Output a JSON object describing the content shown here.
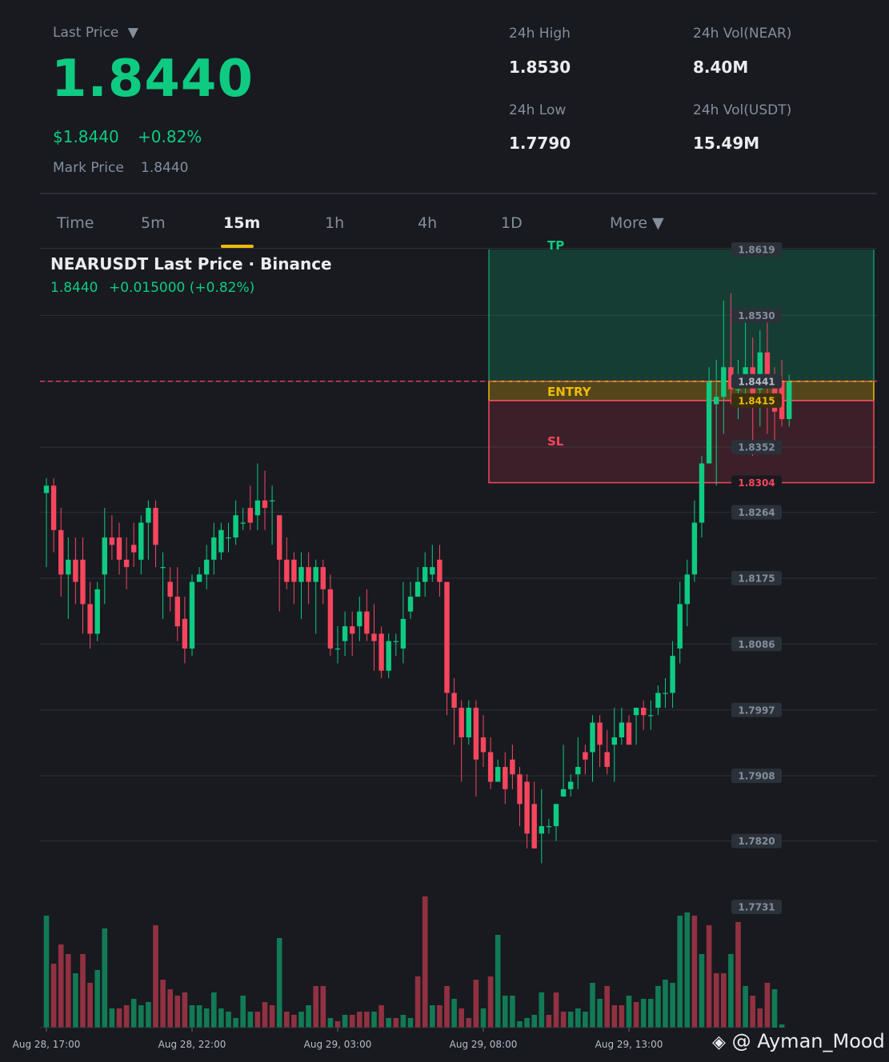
{
  "header": {
    "last_price_label": "Last Price",
    "last_price_caret": "▼",
    "last_price": "1.8440",
    "usd_price": "$1.8440",
    "change_pct": "+0.82%",
    "mark_price_label": "Mark Price",
    "mark_price": "1.8440",
    "stats": [
      {
        "label": "24h High",
        "value": "1.8530"
      },
      {
        "label": "24h Vol(NEAR)",
        "value": "8.40M"
      },
      {
        "label": "24h Low",
        "value": "1.7790"
      },
      {
        "label": "24h Vol(USDT)",
        "value": "15.49M"
      }
    ]
  },
  "tabs": [
    {
      "label": "Time",
      "active": false
    },
    {
      "label": "5m",
      "active": false
    },
    {
      "label": "15m",
      "active": true
    },
    {
      "label": "1h",
      "active": false
    },
    {
      "label": "4h",
      "active": false
    },
    {
      "label": "1D",
      "active": false
    },
    {
      "label": "More ▼",
      "active": false
    }
  ],
  "chart": {
    "title": "NEARUSDT Last Price · Binance",
    "price": "1.8440",
    "change": "+0.015000 (+0.82%)",
    "tp_label": "TP",
    "entry_label": "ENTRY",
    "sl_label": "SL",
    "watermark": "@ Ayman_Mood",
    "colors": {
      "up": "#0ecb81",
      "down": "#f6465d",
      "entry": "#f0b90b",
      "background": "#181a20"
    }
  },
  "chart_data": {
    "type": "candlestick",
    "symbol": "NEARUSDT",
    "interval": "15m",
    "ylim": [
      1.7731,
      1.8619
    ],
    "y_ticks": [
      "1.8619",
      "1.8530",
      "1.8441",
      "1.8352",
      "1.8264",
      "1.8175",
      "1.8086",
      "1.7997",
      "1.7908",
      "1.7820",
      "1.7731"
    ],
    "x_ticks": [
      {
        "label": "Aug 28, 17:00",
        "index": 0
      },
      {
        "label": "Aug 28, 22:00",
        "index": 20
      },
      {
        "label": "Aug 29, 03:00",
        "index": 40
      },
      {
        "label": "Aug 29, 08:00",
        "index": 60
      },
      {
        "label": "Aug 29, 13:00",
        "index": 80
      }
    ],
    "price_tags": [
      {
        "label": "1.8441",
        "value": 1.8441,
        "kind": "last"
      },
      {
        "label": "1.8415",
        "value": 1.8415,
        "kind": "entry"
      },
      {
        "label": "1.8304",
        "value": 1.8304,
        "kind": "sl"
      }
    ],
    "position": {
      "tp": 1.8619,
      "entry": 1.8415,
      "sl": 1.8304,
      "last": 1.8441,
      "start_index": 62
    },
    "candles": [
      [
        1.829,
        1.83,
        1.831,
        1.819
      ],
      [
        1.83,
        1.824,
        1.831,
        1.821
      ],
      [
        1.824,
        1.818,
        1.827,
        1.815
      ],
      [
        1.818,
        1.82,
        1.823,
        1.812
      ],
      [
        1.82,
        1.817,
        1.823,
        1.814
      ],
      [
        1.82,
        1.814,
        1.823,
        1.81
      ],
      [
        1.814,
        1.81,
        1.817,
        1.808
      ],
      [
        1.81,
        1.816,
        1.817,
        1.809
      ],
      [
        1.818,
        1.823,
        1.827,
        1.814
      ],
      [
        1.823,
        1.822,
        1.826,
        1.82
      ],
      [
        1.823,
        1.82,
        1.825,
        1.818
      ],
      [
        1.82,
        1.819,
        1.823,
        1.816
      ],
      [
        1.822,
        1.821,
        1.825,
        1.819
      ],
      [
        1.82,
        1.825,
        1.826,
        1.818
      ],
      [
        1.825,
        1.827,
        1.828,
        1.82
      ],
      [
        1.827,
        1.822,
        1.828,
        1.819
      ],
      [
        1.819,
        1.819,
        1.821,
        1.812
      ],
      [
        1.817,
        1.815,
        1.819,
        1.813
      ],
      [
        1.815,
        1.811,
        1.819,
        1.809
      ],
      [
        1.812,
        1.808,
        1.815,
        1.806
      ],
      [
        1.808,
        1.817,
        1.818,
        1.807
      ],
      [
        1.817,
        1.818,
        1.819,
        1.817
      ],
      [
        1.818,
        1.82,
        1.822,
        1.816
      ],
      [
        1.82,
        1.823,
        1.825,
        1.818
      ],
      [
        1.821,
        1.824,
        1.825,
        1.82
      ],
      [
        1.823,
        1.823,
        1.825,
        1.821
      ],
      [
        1.823,
        1.826,
        1.828,
        1.822
      ],
      [
        1.825,
        1.825,
        1.827,
        1.824
      ],
      [
        1.827,
        1.825,
        1.83,
        1.824
      ],
      [
        1.826,
        1.828,
        1.833,
        1.824
      ],
      [
        1.828,
        1.827,
        1.832,
        1.824
      ],
      [
        1.828,
        1.828,
        1.83,
        1.822
      ],
      [
        1.826,
        1.82,
        1.826,
        1.813
      ],
      [
        1.82,
        1.817,
        1.823,
        1.816
      ],
      [
        1.82,
        1.817,
        1.821,
        1.814
      ],
      [
        1.817,
        1.819,
        1.821,
        1.812
      ],
      [
        1.819,
        1.817,
        1.821,
        1.814
      ],
      [
        1.817,
        1.819,
        1.82,
        1.81
      ],
      [
        1.819,
        1.816,
        1.82,
        1.814
      ],
      [
        1.816,
        1.808,
        1.818,
        1.807
      ],
      [
        1.808,
        1.808,
        1.811,
        1.806
      ],
      [
        1.809,
        1.811,
        1.813,
        1.807
      ],
      [
        1.811,
        1.81,
        1.813,
        1.807
      ],
      [
        1.811,
        1.813,
        1.815,
        1.809
      ],
      [
        1.813,
        1.81,
        1.816,
        1.809
      ],
      [
        1.81,
        1.809,
        1.814,
        1.805
      ],
      [
        1.81,
        1.805,
        1.811,
        1.804
      ],
      [
        1.805,
        1.809,
        1.81,
        1.804
      ],
      [
        1.809,
        1.809,
        1.81,
        1.807
      ],
      [
        1.808,
        1.812,
        1.817,
        1.806
      ],
      [
        1.813,
        1.815,
        1.817,
        1.812
      ],
      [
        1.815,
        1.817,
        1.819,
        1.815
      ],
      [
        1.817,
        1.819,
        1.821,
        1.815
      ],
      [
        1.818,
        1.819,
        1.822,
        1.817
      ],
      [
        1.82,
        1.817,
        1.822,
        1.815
      ],
      [
        1.817,
        1.802,
        1.816,
        1.799
      ],
      [
        1.802,
        1.8,
        1.804,
        1.795
      ],
      [
        1.8,
        1.796,
        1.801,
        1.79
      ],
      [
        1.796,
        1.8,
        1.801,
        1.795
      ],
      [
        1.8,
        1.793,
        1.801,
        1.788
      ],
      [
        1.796,
        1.794,
        1.799,
        1.792
      ],
      [
        1.794,
        1.79,
        1.796,
        1.789
      ],
      [
        1.79,
        1.792,
        1.793,
        1.79
      ],
      [
        1.792,
        1.789,
        1.794,
        1.787
      ],
      [
        1.793,
        1.791,
        1.795,
        1.789
      ],
      [
        1.791,
        1.787,
        1.792,
        1.784
      ],
      [
        1.79,
        1.783,
        1.791,
        1.781
      ],
      [
        1.787,
        1.781,
        1.79,
        1.781
      ],
      [
        1.783,
        1.784,
        1.789,
        1.779
      ],
      [
        1.784,
        1.784,
        1.785,
        1.783
      ],
      [
        1.784,
        1.787,
        1.787,
        1.782
      ],
      [
        1.788,
        1.789,
        1.795,
        1.788
      ],
      [
        1.789,
        1.79,
        1.791,
        1.788
      ],
      [
        1.791,
        1.792,
        1.796,
        1.789
      ],
      [
        1.794,
        1.793,
        1.795,
        1.791
      ],
      [
        1.794,
        1.798,
        1.799,
        1.79
      ],
      [
        1.798,
        1.795,
        1.799,
        1.792
      ],
      [
        1.794,
        1.792,
        1.797,
        1.791
      ],
      [
        1.795,
        1.796,
        1.8,
        1.79
      ],
      [
        1.796,
        1.798,
        1.8,
        1.795
      ],
      [
        1.798,
        1.795,
        1.799,
        1.795
      ],
      [
        1.799,
        1.8,
        1.8,
        1.795
      ],
      [
        1.8,
        1.799,
        1.801,
        1.797
      ],
      [
        1.799,
        1.799,
        1.801,
        1.797
      ],
      [
        1.8,
        1.802,
        1.803,
        1.799
      ],
      [
        1.802,
        1.802,
        1.804,
        1.8
      ],
      [
        1.802,
        1.807,
        1.809,
        1.8
      ],
      [
        1.808,
        1.814,
        1.817,
        1.806
      ],
      [
        1.814,
        1.818,
        1.82,
        1.811
      ],
      [
        1.818,
        1.825,
        1.828,
        1.817
      ],
      [
        1.825,
        1.833,
        1.834,
        1.823
      ],
      [
        1.833,
        1.844,
        1.846,
        1.833
      ],
      [
        1.841,
        1.842,
        1.847,
        1.83
      ],
      [
        1.842,
        1.846,
        1.855,
        1.837
      ],
      [
        1.846,
        1.843,
        1.856,
        1.841
      ],
      [
        1.843,
        1.843,
        1.847,
        1.839
      ],
      [
        1.844,
        1.846,
        1.854,
        1.842
      ],
      [
        1.846,
        1.841,
        1.85,
        1.834
      ],
      [
        1.843,
        1.848,
        1.851,
        1.838
      ],
      [
        1.848,
        1.844,
        1.854,
        1.837
      ],
      [
        1.845,
        1.84,
        1.846,
        1.836
      ],
      [
        1.844,
        1.839,
        1.847,
        1.838
      ],
      [
        1.839,
        1.844,
        1.845,
        1.838
      ]
    ],
    "volume": [
      [
        3.5,
        1
      ],
      [
        2.0,
        0
      ],
      [
        2.6,
        0
      ],
      [
        2.3,
        0
      ],
      [
        1.7,
        1
      ],
      [
        2.3,
        0
      ],
      [
        1.4,
        0
      ],
      [
        1.8,
        1
      ],
      [
        3.1,
        1
      ],
      [
        0.6,
        1
      ],
      [
        0.6,
        0
      ],
      [
        0.7,
        0
      ],
      [
        0.9,
        1
      ],
      [
        0.7,
        1
      ],
      [
        0.8,
        1
      ],
      [
        3.2,
        0
      ],
      [
        1.5,
        0
      ],
      [
        1.2,
        0
      ],
      [
        1.0,
        0
      ],
      [
        1.1,
        0
      ],
      [
        0.7,
        1
      ],
      [
        0.7,
        1
      ],
      [
        0.6,
        1
      ],
      [
        1.1,
        1
      ],
      [
        0.6,
        1
      ],
      [
        0.5,
        1
      ],
      [
        0.3,
        1
      ],
      [
        1.0,
        1
      ],
      [
        0.5,
        1
      ],
      [
        0.5,
        0
      ],
      [
        0.8,
        0
      ],
      [
        0.7,
        0
      ],
      [
        2.8,
        1
      ],
      [
        0.5,
        0
      ],
      [
        0.4,
        0
      ],
      [
        0.5,
        1
      ],
      [
        0.7,
        1
      ],
      [
        1.3,
        0
      ],
      [
        1.3,
        0
      ],
      [
        0.3,
        1
      ],
      [
        0.2,
        0
      ],
      [
        0.4,
        1
      ],
      [
        0.4,
        0
      ],
      [
        0.5,
        0
      ],
      [
        0.5,
        0
      ],
      [
        0.5,
        1
      ],
      [
        0.7,
        0
      ],
      [
        0.3,
        1
      ],
      [
        0.3,
        0
      ],
      [
        0.4,
        1
      ],
      [
        0.3,
        1
      ],
      [
        1.6,
        0
      ],
      [
        4.1,
        0
      ],
      [
        0.7,
        1
      ],
      [
        0.7,
        0
      ],
      [
        1.3,
        0
      ],
      [
        0.9,
        1
      ],
      [
        0.6,
        0
      ],
      [
        0.3,
        0
      ],
      [
        1.5,
        0
      ],
      [
        0.6,
        1
      ],
      [
        1.6,
        0
      ],
      [
        2.9,
        1
      ],
      [
        1.0,
        1
      ],
      [
        1.0,
        1
      ],
      [
        0.2,
        1
      ],
      [
        0.3,
        1
      ],
      [
        0.4,
        1
      ],
      [
        1.1,
        1
      ],
      [
        0.4,
        0
      ],
      [
        1.1,
        0
      ],
      [
        0.5,
        0
      ],
      [
        0.5,
        1
      ],
      [
        0.6,
        1
      ],
      [
        0.5,
        1
      ],
      [
        1.4,
        1
      ],
      [
        0.9,
        1
      ],
      [
        1.3,
        0
      ],
      [
        0.7,
        0
      ],
      [
        0.7,
        0
      ],
      [
        1.0,
        1
      ],
      [
        0.8,
        0
      ],
      [
        0.9,
        1
      ],
      [
        0.9,
        1
      ],
      [
        1.3,
        1
      ],
      [
        1.5,
        1
      ],
      [
        1.4,
        1
      ],
      [
        3.5,
        1
      ],
      [
        3.6,
        1
      ],
      [
        3.5,
        0
      ],
      [
        2.3,
        1
      ],
      [
        3.2,
        0
      ],
      [
        1.7,
        0
      ],
      [
        1.7,
        0
      ],
      [
        2.3,
        1
      ],
      [
        3.3,
        0
      ],
      [
        1.3,
        1
      ],
      [
        1.0,
        0
      ],
      [
        0.6,
        0
      ],
      [
        1.4,
        0
      ],
      [
        1.2,
        1
      ],
      [
        0.1,
        1
      ]
    ]
  }
}
